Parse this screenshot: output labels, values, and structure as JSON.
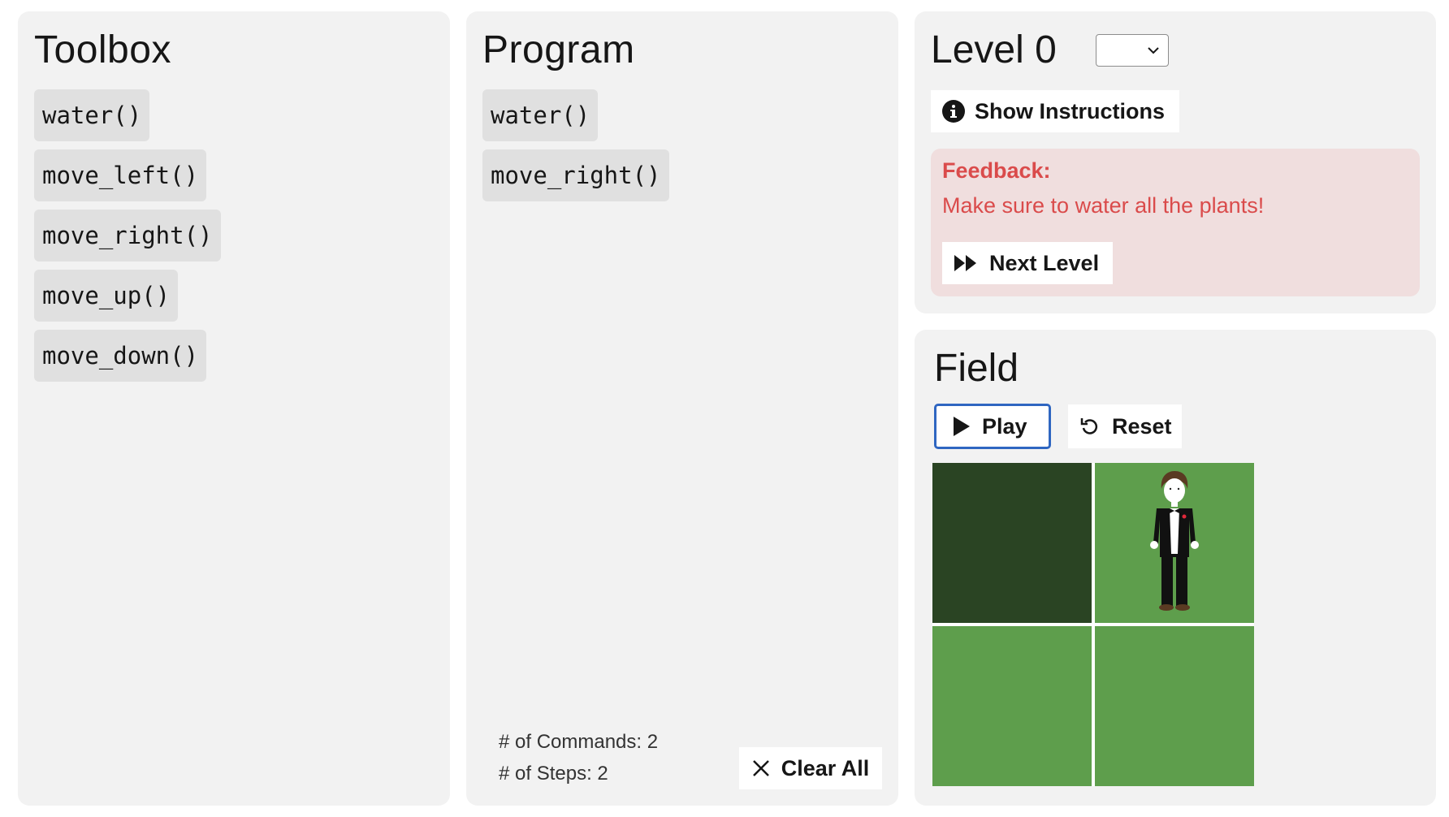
{
  "toolbox": {
    "title": "Toolbox",
    "commands": [
      "water()",
      "move_left()",
      "move_right()",
      "move_up()",
      "move_down()"
    ]
  },
  "program": {
    "title": "Program",
    "commands": [
      "water()",
      "move_right()"
    ],
    "commands_count_label": "# of Commands: 2",
    "steps_count_label": "# of Steps: 2",
    "clear_all_label": "Clear All",
    "clear_icon": "close-icon"
  },
  "level": {
    "title": "Level 0",
    "select_value": "",
    "show_instructions_label": "Show Instructions",
    "instructions_icon": "info-icon"
  },
  "feedback": {
    "title": "Feedback:",
    "message": "Make sure to water all the plants!",
    "next_level_label": "Next Level",
    "next_icon": "fast-forward-icon",
    "color": "#da4b4b",
    "background": "#f0dede"
  },
  "field": {
    "title": "Field",
    "play_label": "Play",
    "reset_label": "Reset",
    "grid": [
      [
        "watered",
        "dry"
      ],
      [
        "dry",
        "dry"
      ]
    ],
    "character_position": {
      "row": 0,
      "col": 1
    },
    "colors": {
      "watered": "#2a4423",
      "dry": "#5e9e4c",
      "play_border": "#2f66c1"
    }
  }
}
